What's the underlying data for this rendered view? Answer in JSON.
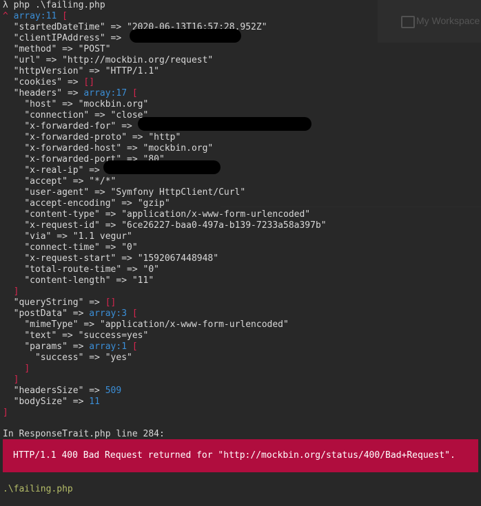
{
  "background_app": {
    "title": "My Workspace"
  },
  "prompt": {
    "symbol": "λ",
    "command": "php .\\failing.php"
  },
  "dump": {
    "caret": "^",
    "root_type": "array:11",
    "open_bracket": "[",
    "close_bracket": "]",
    "started_key": "\"startedDateTime\"",
    "started_value": "\"2020-06-13T16:57:28.952Z\"",
    "client_ip_key": "\"clientIPAddress\"",
    "method_key": "\"method\"",
    "method_value": "\"POST\"",
    "url_key": "\"url\"",
    "url_value": "\"http://mockbin.org/request\"",
    "http_version_key": "\"httpVersion\"",
    "http_version_value": "\"HTTP/1.1\"",
    "cookies_key": "\"cookies\"",
    "cookies_value": "[]",
    "headers_key": "\"headers\"",
    "headers_type": "array:17",
    "headers": [
      {
        "key": "\"host\"",
        "value": "\"mockbin.org\""
      },
      {
        "key": "\"connection\"",
        "value": "\"close\""
      },
      {
        "key": "\"x-forwarded-for\"",
        "value": ""
      },
      {
        "key": "\"x-forwarded-proto\"",
        "value": "\"http\""
      },
      {
        "key": "\"x-forwarded-host\"",
        "value": "\"mockbin.org\""
      },
      {
        "key": "\"x-forwarded-port\"",
        "value": "\"80\""
      },
      {
        "key": "\"x-real-ip\"",
        "value": ""
      },
      {
        "key": "\"accept\"",
        "value": "\"*/*\""
      },
      {
        "key": "\"user-agent\"",
        "value": "\"Symfony HttpClient/Curl\""
      },
      {
        "key": "\"accept-encoding\"",
        "value": "\"gzip\""
      },
      {
        "key": "\"content-type\"",
        "value": "\"application/x-www-form-urlencoded\""
      },
      {
        "key": "\"x-request-id\"",
        "value": "\"6ce26227-baa0-497a-b139-7233a58a397b\""
      },
      {
        "key": "\"via\"",
        "value": "\"1.1 vegur\""
      },
      {
        "key": "\"connect-time\"",
        "value": "\"0\""
      },
      {
        "key": "\"x-request-start\"",
        "value": "\"1592067448948\""
      },
      {
        "key": "\"total-route-time\"",
        "value": "\"0\""
      },
      {
        "key": "\"content-length\"",
        "value": "\"11\""
      }
    ],
    "query_string_key": "\"queryString\"",
    "query_string_value": "[]",
    "post_data_key": "\"postData\"",
    "post_data_type": "array:3",
    "mime_type_key": "\"mimeType\"",
    "mime_type_value": "\"application/x-www-form-urlencoded\"",
    "text_key": "\"text\"",
    "text_value": "\"success=yes\"",
    "params_key": "\"params\"",
    "params_type": "array:1",
    "success_key": "\"success\"",
    "success_value": "\"yes\"",
    "headers_size_key": "\"headersSize\"",
    "headers_size_value": "509",
    "body_size_key": "\"bodySize\"",
    "body_size_value": "11",
    "arrow": "=>"
  },
  "error": {
    "location": "In ResponseTrait.php line 284:",
    "message": "HTTP/1.1 400 Bad Request returned for \"http://mockbin.org/status/400/Bad+Request\"."
  },
  "footer": {
    "script": ".\\failing.php"
  }
}
